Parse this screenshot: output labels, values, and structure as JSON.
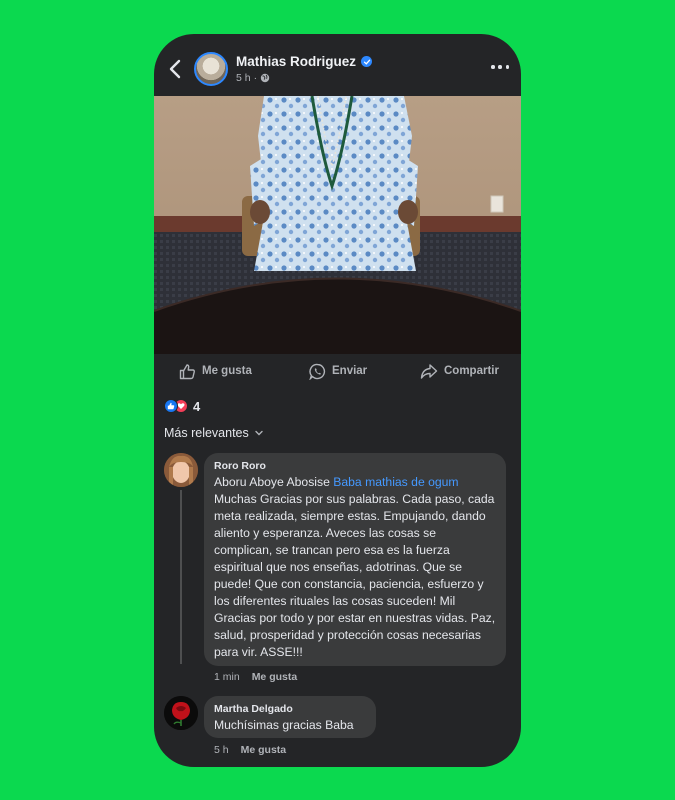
{
  "post": {
    "author": "Mathias Rodriguez",
    "time": "5 h",
    "separator": "·"
  },
  "actions": {
    "like": "Me gusta",
    "send": "Enviar",
    "share": "Compartir"
  },
  "reactions": {
    "count": "4"
  },
  "sort": {
    "label": "Más relevantes"
  },
  "comments": [
    {
      "name": "Roro Roro",
      "prefix": "Aboru Aboye Abosise ",
      "mention": "Baba mathias de ogum",
      "body": "Muchas  Gracias por sus palabras. Cada paso, cada meta realizada, siempre estas. Empujando, dando aliento y esperanza. Aveces las cosas se complican, se trancan pero esa es la fuerza espiritual que nos enseñas, adotrinas. Que se puede! Que con constancia, paciencia, esfuerzo y los diferentes rituales las cosas suceden! Mil Gracias por todo y por estar en nuestras vidas. Paz, salud, prosperidad y protección cosas necesarias para vir. ASSE!!!",
      "time": "1 min",
      "like": "Me gusta"
    },
    {
      "name": "Martha Delgado",
      "body": "Muchísimas  gracias Baba",
      "time": "5 h",
      "like": "Me gusta"
    }
  ],
  "colors": {
    "background": "#0bd94f",
    "surface": "#242527",
    "bubble": "#3a3b3c",
    "accent": "#2d88ff",
    "mention": "#4599ff",
    "love": "#f33e58"
  }
}
